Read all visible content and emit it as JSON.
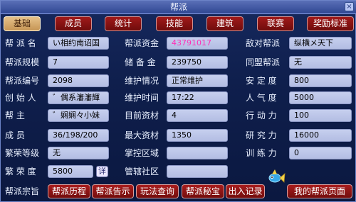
{
  "window": {
    "title": "帮派",
    "close_glyph": "×"
  },
  "tabs": [
    {
      "label": "基础",
      "active": true
    },
    {
      "label": "成员",
      "active": false
    },
    {
      "label": "统计",
      "active": false
    },
    {
      "label": "技能",
      "active": false
    },
    {
      "label": "建筑",
      "active": false
    },
    {
      "label": "联赛",
      "active": false
    },
    {
      "label": "奖励标准",
      "active": false
    }
  ],
  "info": {
    "name": {
      "label": "帮 派 名",
      "value": "い相约南诏国"
    },
    "rules": {
      "label": "帮派规模",
      "value": "7"
    },
    "code": {
      "label": "帮派编号",
      "value": "2098"
    },
    "founder": {
      "label": "创 始 人",
      "value": "゛偶系瀋瀋輝"
    },
    "leader": {
      "label": "帮      主",
      "value": "゛娴娴々小妹"
    },
    "members": {
      "label": "成      员",
      "value": "36/198/200"
    },
    "prosperity_lv": {
      "label": "繁荣等级",
      "value": "无"
    },
    "prosperity": {
      "label": "繁 荣 度",
      "value": "5800"
    },
    "funds": {
      "label": "帮派资金",
      "value": "43791017"
    },
    "reserve": {
      "label": "储 备 金",
      "value": "239750"
    },
    "maintain": {
      "label": "维护情况",
      "value": "正常维护"
    },
    "maintain_time": {
      "label": "维护时间",
      "value": "17:22"
    },
    "cur_material": {
      "label": "目前资材",
      "value": "4"
    },
    "max_material": {
      "label": "最大资材",
      "value": "1350"
    },
    "control_zone": {
      "label": "掌控区域",
      "value": ""
    },
    "community": {
      "label": "管辖社区",
      "value": ""
    },
    "enemy": {
      "label": "敌对帮派",
      "value": "纵横メ天下"
    },
    "ally": {
      "label": "同盟帮派",
      "value": "无"
    },
    "stability": {
      "label": "安 定 度",
      "value": "800"
    },
    "popularity": {
      "label": "人 气 度",
      "value": "5000"
    },
    "action": {
      "label": "行 动 力",
      "value": "100"
    },
    "research": {
      "label": "研 究 力",
      "value": "16000"
    },
    "training": {
      "label": "训 练 力",
      "value": "0"
    }
  },
  "detail_button": "详",
  "footer": {
    "motto_label": "帮派宗旨",
    "buttons": [
      "帮派历程",
      "帮派告示",
      "玩法查询",
      "帮派秘宝",
      "出入记录",
      "我的帮派页面"
    ]
  },
  "colors": {
    "tab_red": "#8a1212",
    "tab_active": "#d6ad70",
    "field_bg": "#bdc6ea",
    "funds_text": "#ff2fb5"
  }
}
